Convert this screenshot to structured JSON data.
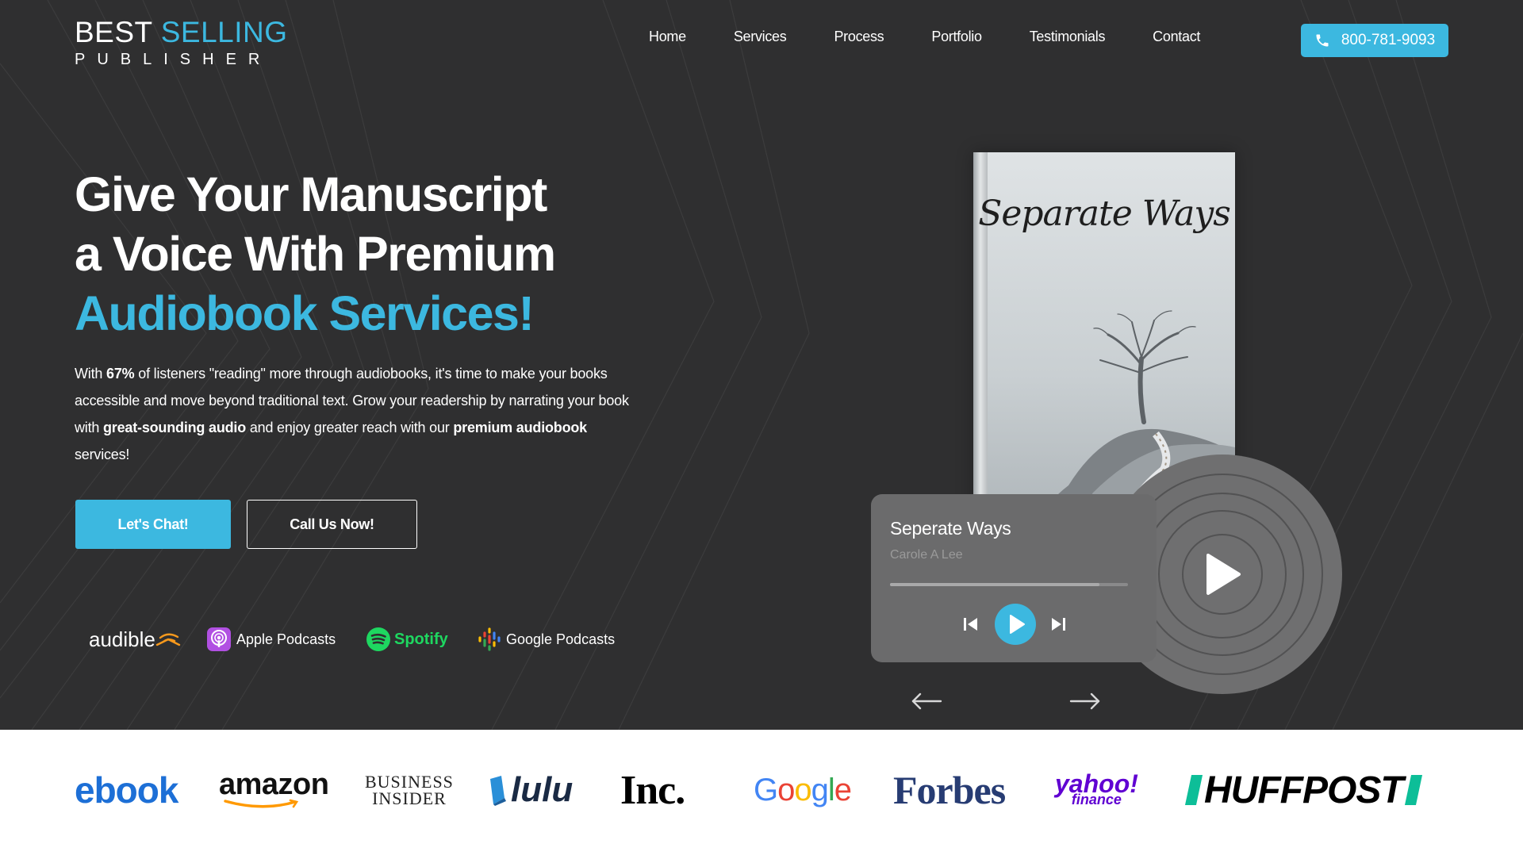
{
  "header": {
    "logo_top_plain": "BEST ",
    "logo_top_accent": "SELLING",
    "logo_bottom": "PUBLISHER",
    "nav": [
      "Home",
      "Services",
      "Process",
      "Portfolio",
      "Testimonials",
      "Contact"
    ],
    "phone": "800-781-9093"
  },
  "hero": {
    "headline_line1": "Give Your Manuscript",
    "headline_line2": "a Voice With Premium",
    "headline_accent": "Audiobook Services!",
    "intro": {
      "t1": "With ",
      "b1": "67%",
      "t2": " of listeners \"reading\" more through audiobooks, it's time to make your books accessible and move beyond traditional text. Grow your readership by narrating your book with ",
      "b2": "great-sounding audio",
      "t3": " and enjoy greater reach with our ",
      "b3": "premium audiobook",
      "t4": " services!"
    },
    "cta_primary": "Let's Chat!",
    "cta_secondary": "Call Us Now!",
    "platforms": {
      "audible": "audible",
      "apple": "Apple Podcasts",
      "spotify": "Spotify",
      "google": "Google Podcasts"
    }
  },
  "book": {
    "cover_title": "Separate Ways"
  },
  "player": {
    "track_title": "Seperate Ways",
    "artist": "Carole A Lee",
    "progress_fraction": 0.88
  },
  "brands": {
    "ebook": "ebook",
    "amazon": "amazon",
    "bi_line1": "BUSINESS",
    "bi_line2": "INSIDER",
    "lulu": "lulu",
    "inc": "Inc.",
    "google_letters": [
      "G",
      "o",
      "o",
      "g",
      "l",
      "e"
    ],
    "forbes": "Forbes",
    "yahoo": "yahoo!",
    "yahoo_sub": "finance",
    "huffpost": "HUFFPOST"
  },
  "colors": {
    "accent": "#3cb8e0",
    "hero_bg": "#2f2f30",
    "spotify_green": "#1ed760",
    "google": [
      "#4285f4",
      "#ea4335",
      "#fbbc05",
      "#4285f4",
      "#34a853",
      "#ea4335"
    ]
  },
  "icons": {
    "phone": "phone-icon",
    "audible": "audible-icon",
    "apple": "apple-podcasts-icon",
    "spotify": "spotify-icon",
    "google": "google-podcasts-icon",
    "prev": "previous-track-icon",
    "play": "play-icon",
    "next": "next-track-icon",
    "arrow_left": "arrow-left-icon",
    "arrow_right": "arrow-right-icon"
  }
}
